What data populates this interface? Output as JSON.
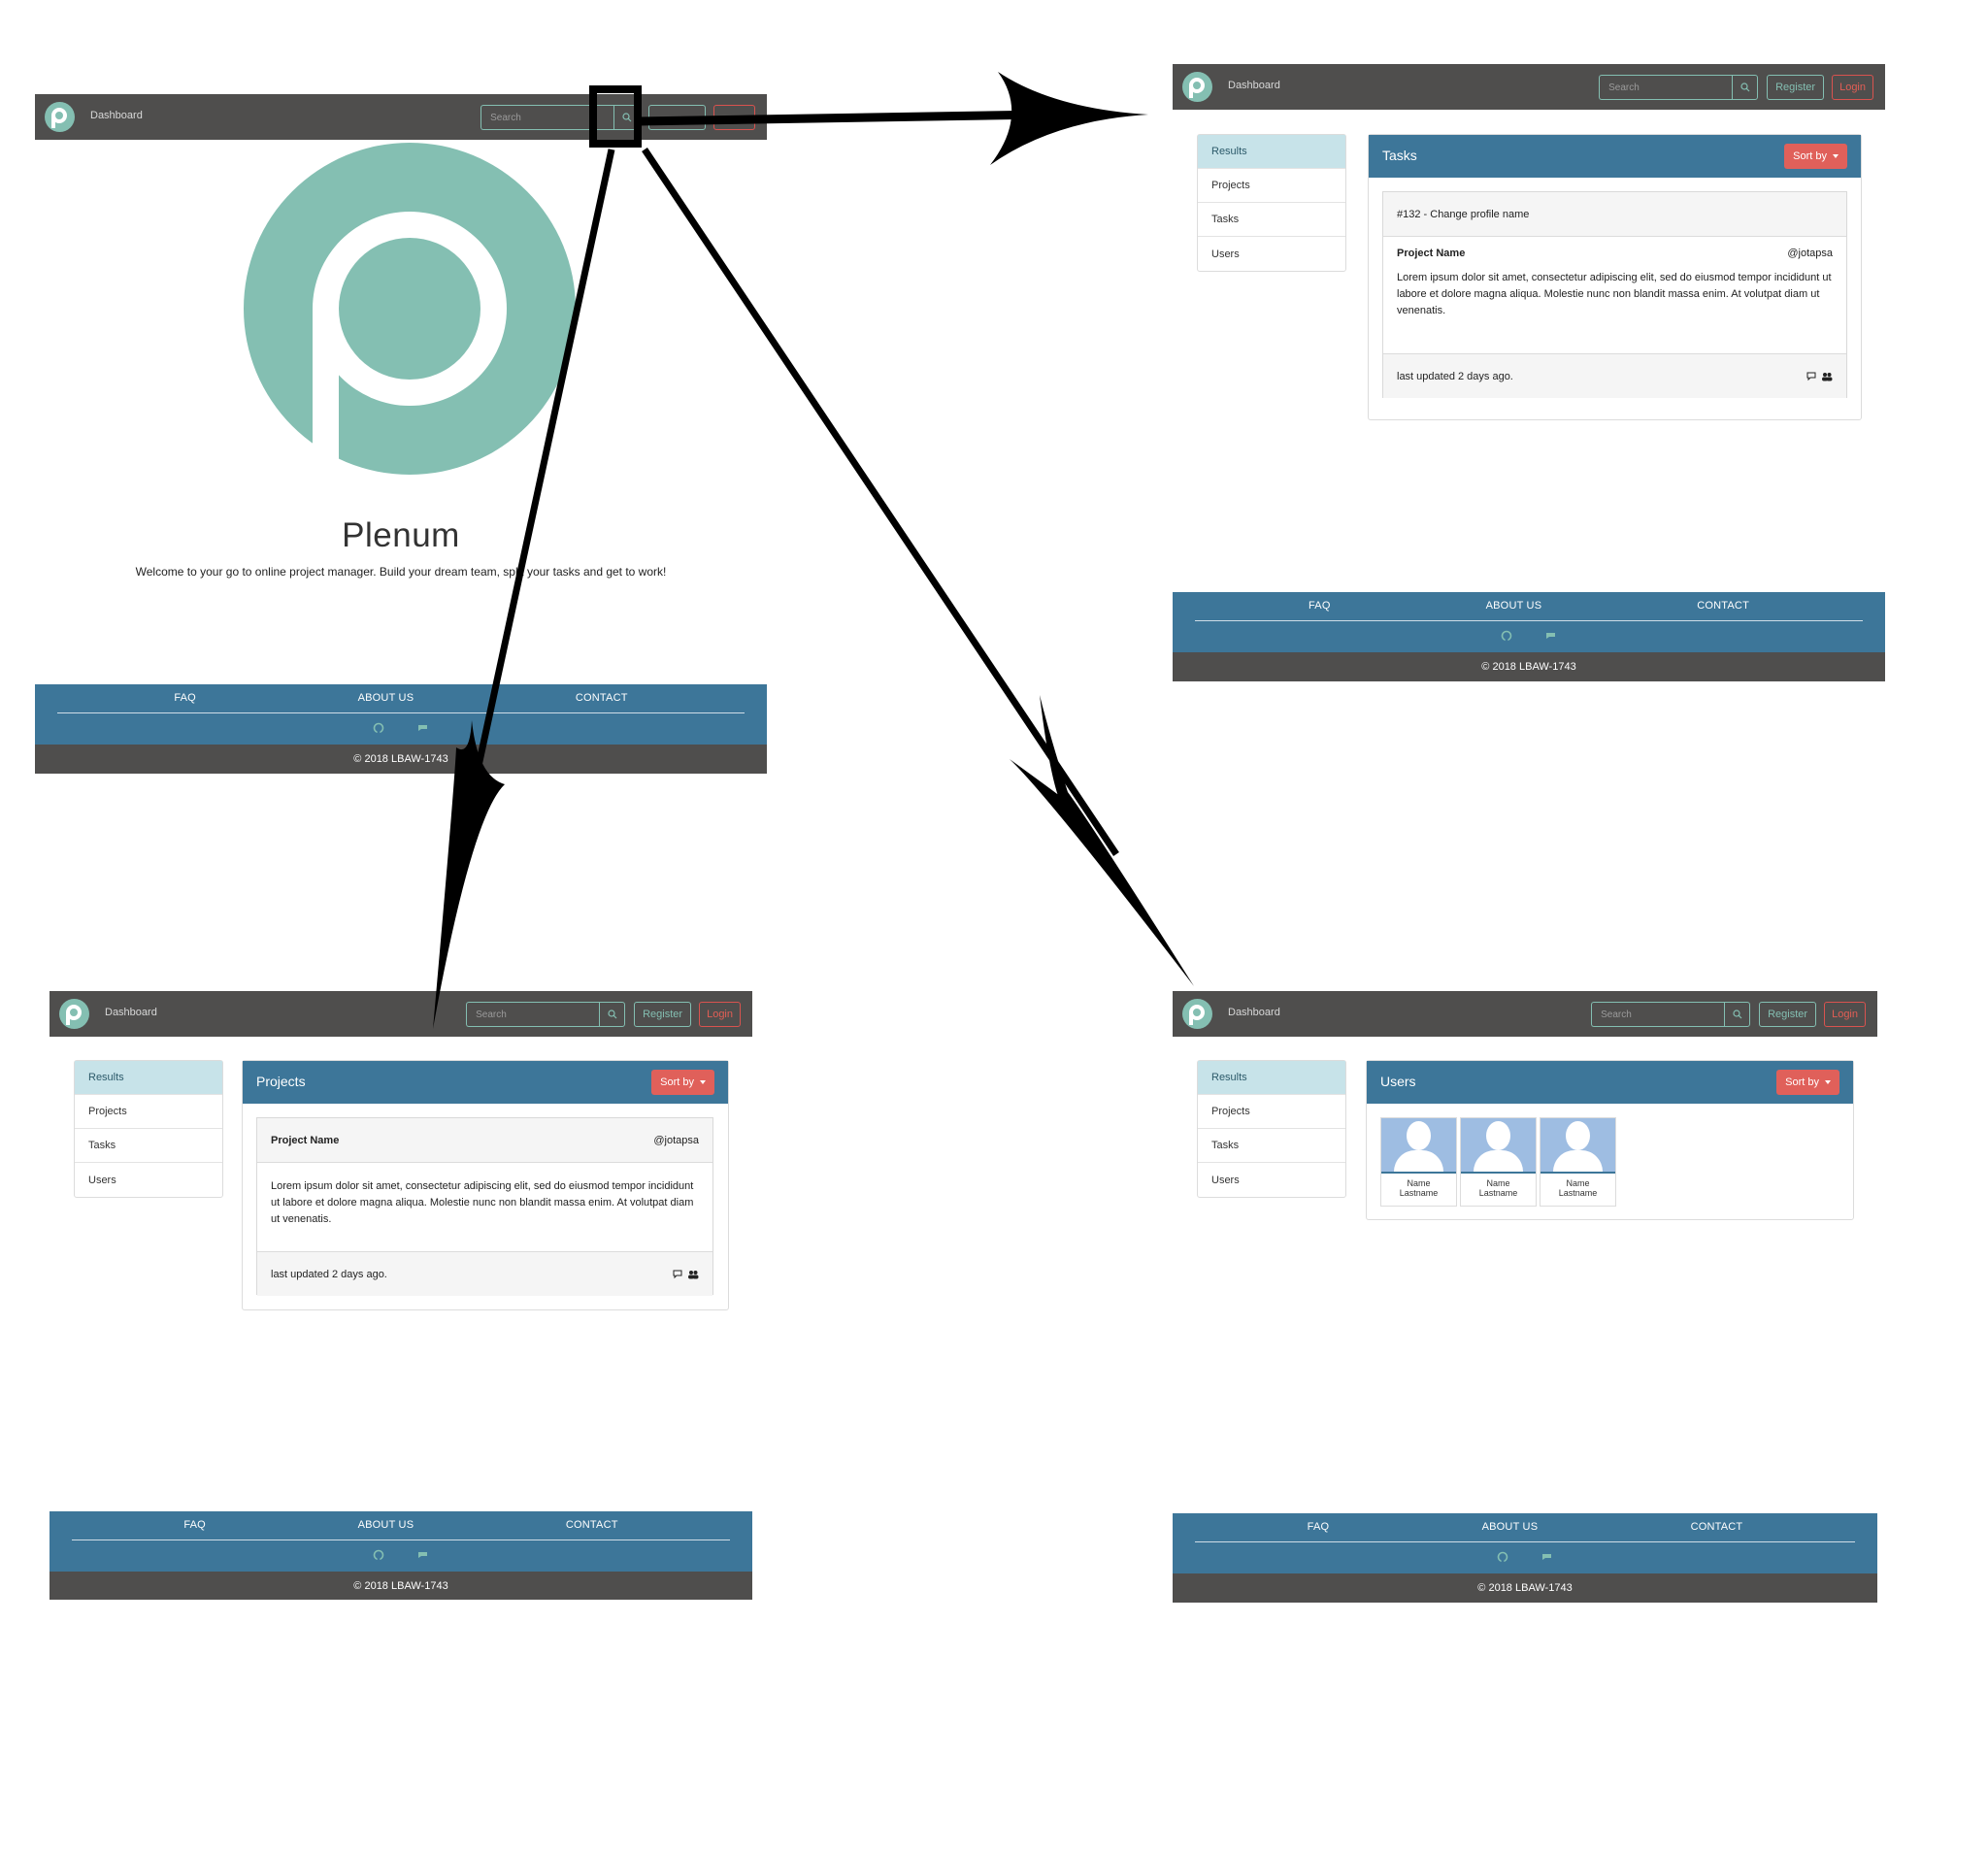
{
  "navbar": {
    "title": "Dashboard",
    "search_placeholder": "Search",
    "register_label": "Register",
    "login_label": "Login"
  },
  "footer": {
    "links": [
      "FAQ",
      "ABOUT US",
      "CONTACT"
    ],
    "copyright": "© 2018 LBAW-1743"
  },
  "landing": {
    "brand": "Plenum",
    "welcome": "Welcome to your go to online project manager. Build your dream team, split your tasks and get to work!"
  },
  "sidebar": {
    "items": [
      "Results",
      "Projects",
      "Tasks",
      "Users"
    ]
  },
  "sort_label": "Sort by",
  "tasks_page": {
    "title": "Tasks",
    "task_header": "#132 - Change profile name",
    "project_name": "Project Name",
    "author": "@jotapsa",
    "description": "Lorem ipsum dolor sit amet, consectetur adipiscing elit, sed do eiusmod tempor incididunt ut labore et dolore magna aliqua. Molestie nunc non blandit massa enim. At volutpat diam ut venenatis.",
    "updated": "last updated 2 days ago."
  },
  "projects_page": {
    "title": "Projects",
    "project_name": "Project Name",
    "author": "@jotapsa",
    "description": "Lorem ipsum dolor sit amet, consectetur adipiscing elit, sed do eiusmod tempor incididunt ut labore et dolore magna aliqua. Molestie nunc non blandit massa enim. At volutpat diam ut venenatis.",
    "updated": "last updated 2 days ago."
  },
  "users_page": {
    "title": "Users",
    "users": [
      {
        "first": "Name",
        "last": "Lastname"
      },
      {
        "first": "Name",
        "last": "Lastname"
      },
      {
        "first": "Name",
        "last": "Lastname"
      }
    ]
  },
  "colors": {
    "navbar": "#4f4e4d",
    "accent_teal": "#84bfb2",
    "primary_blue": "#3d7699",
    "danger_red": "#e0605a",
    "active_item": "#c7e3e9"
  },
  "icons": [
    "logo-icon",
    "search-icon",
    "github-icon",
    "chat-icon",
    "comments-icon",
    "users-icon",
    "avatar-placeholder-icon"
  ]
}
